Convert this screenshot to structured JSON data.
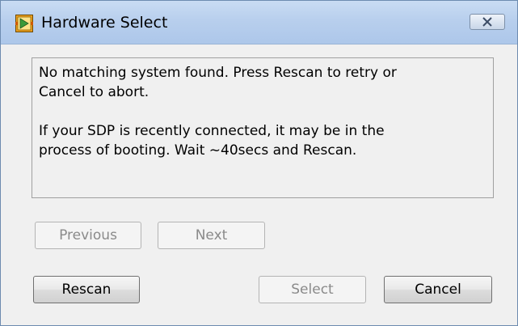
{
  "window": {
    "title": "Hardware Select",
    "icon": "labview-vi-icon",
    "close_icon": "close-icon"
  },
  "message": {
    "line1": "No matching system found. Press Rescan to retry or\nCancel to abort.",
    "line2": "If your SDP is recently connected, it may be in the\nprocess of booting. Wait ~40secs and Rescan."
  },
  "buttons": {
    "previous": "Previous",
    "next": "Next",
    "rescan": "Rescan",
    "select": "Select",
    "cancel": "Cancel"
  },
  "colors": {
    "titlebar": "#b8cfed",
    "dialog_bg": "#f0f0f0",
    "icon_orange": "#f0a020",
    "icon_green": "#3a9a3a"
  }
}
